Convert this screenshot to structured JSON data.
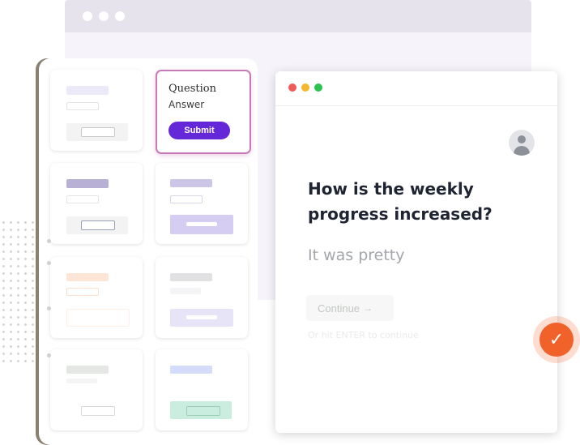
{
  "form_card": {
    "title": "Question",
    "subtitle": "Answer",
    "submit_label": "Submit"
  },
  "preview": {
    "question": "How is the weekly progress increased?",
    "answer_value": "It was pretty",
    "continue_label": "Continue",
    "continue_icon": "arrow-right-icon",
    "hint": "Or hit ENTER to continue"
  },
  "icons": {
    "avatar": "user-avatar-icon",
    "success": "check-icon"
  },
  "colors": {
    "accent": "#6428d8",
    "selected_border": "#c879b8",
    "success": "#f0622a",
    "traffic_red": "#ef5a5a",
    "traffic_yellow": "#f5b72f",
    "traffic_green": "#2cc24f"
  }
}
